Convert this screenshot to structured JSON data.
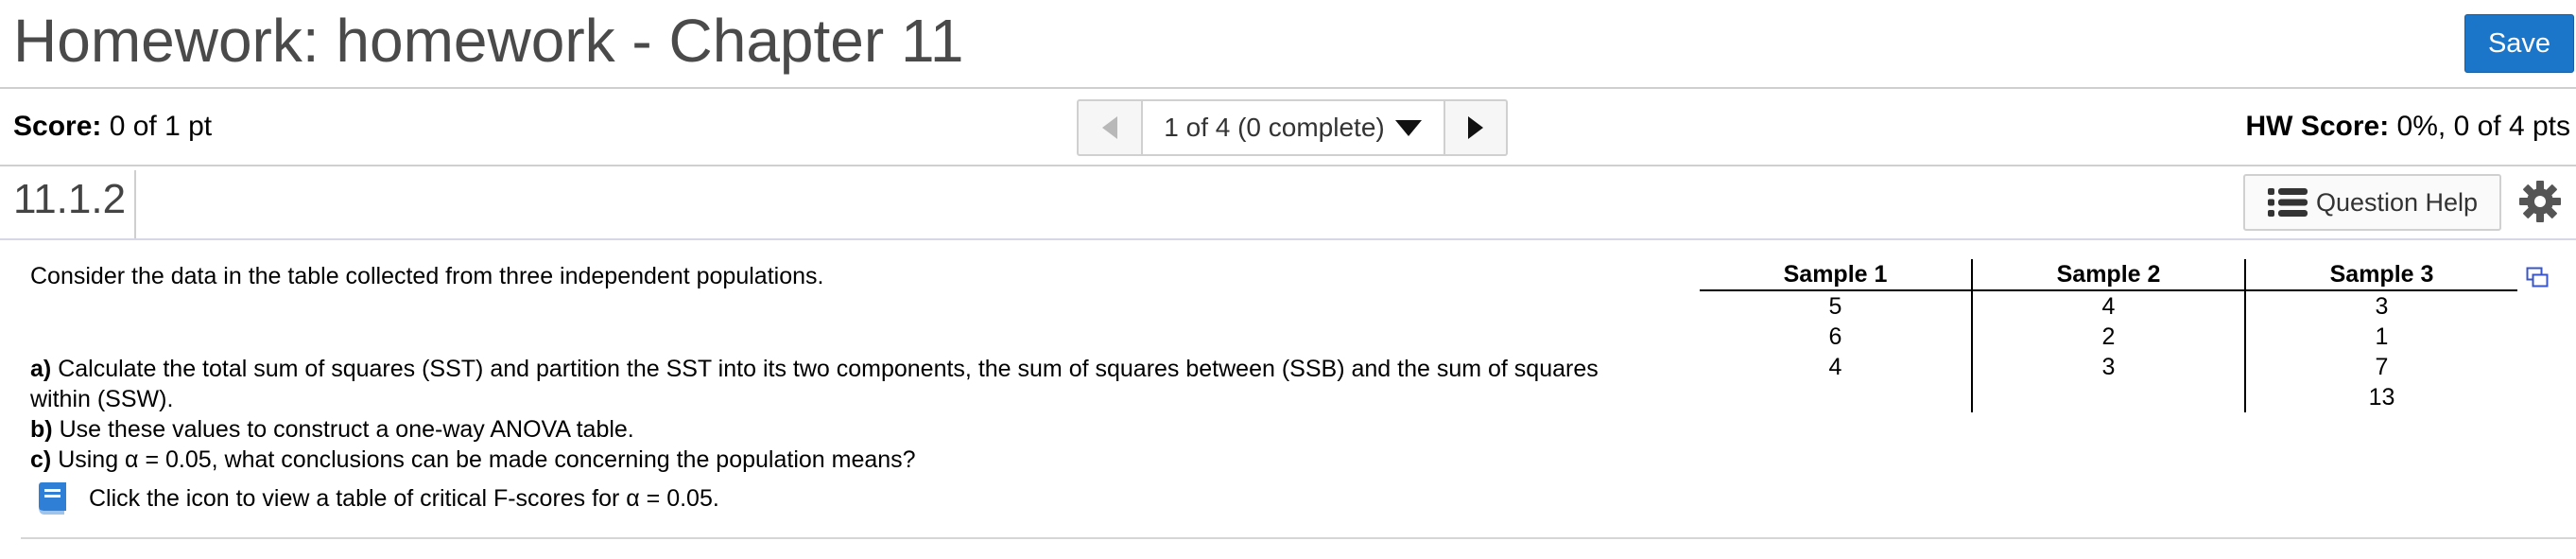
{
  "header": {
    "title": "Homework: homework - Chapter 11",
    "save_label": "Save"
  },
  "score": {
    "label": "Score:",
    "value": "0 of 1 pt"
  },
  "nav": {
    "position": "1 of 4 (0 complete)"
  },
  "hw_score": {
    "label": "HW Score:",
    "value": "0%, 0 of 4 pts"
  },
  "question": {
    "id": "11.1.2",
    "help_label": "Question Help",
    "intro": "Consider the data in the table collected from three independent populations.",
    "part_a_label": "a)",
    "part_a_text": "Calculate the total sum of squares (SST) and  partition the SST into its two components, the sum of squares between (SSB) and the sum of squares within (SSW).",
    "part_b_label": "b)",
    "part_b_text": "Use these values to construct a one-way ANOVA table.",
    "part_c_label": "c)",
    "part_c_text": "Using α = 0.05, what conclusions can be made concerning the population means?",
    "book_text": "Click the icon to view a table of critical F-scores for α = 0.05."
  },
  "table": {
    "headers": [
      "Sample 1",
      "Sample 2",
      "Sample 3"
    ],
    "rows": [
      [
        "5",
        "4",
        "3"
      ],
      [
        "6",
        "2",
        "1"
      ],
      [
        "4",
        "3",
        "7"
      ],
      [
        "",
        "",
        "13"
      ]
    ]
  },
  "colors": {
    "accent": "#1b75c9",
    "divider": "#cfcfcf",
    "book_icon": "#2f7fd6"
  }
}
